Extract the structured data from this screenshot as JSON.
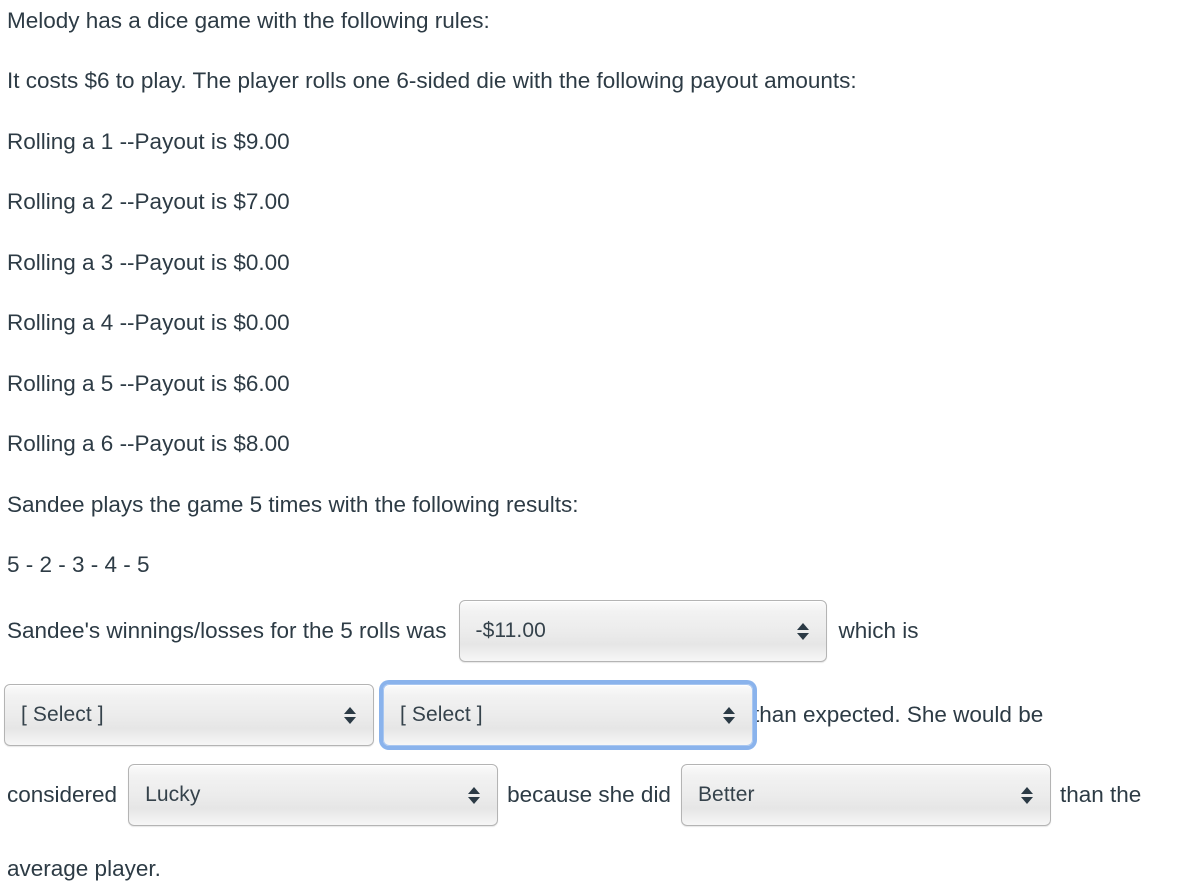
{
  "question": {
    "intro": "Melody has a dice game with the following rules:",
    "cost_line": "It costs $6 to play.  The player rolls one 6-sided die with the following payout amounts:",
    "payouts": [
      "Rolling a 1 --Payout is $9.00",
      "Rolling a 2 --Payout is $7.00",
      "Rolling a 3 --Payout is $0.00",
      "Rolling a 4 --Payout is $0.00",
      "Rolling a 5 --Payout is $6.00",
      "Rolling a 6 --Payout is $8.00"
    ],
    "plays_line": "Sandee plays the game 5 times with the following results:",
    "results_line": "5 - 2 - 3 - 4 - 5",
    "winnings_prefix": "Sandee's winnings/losses for the 5 rolls was",
    "winnings_suffix": "which is",
    "expected_suffix": "than expected.  She would be",
    "considered_prefix": "considered",
    "because_text": "because she did",
    "than_the_text": "than the",
    "last_line": "average player."
  },
  "dropdowns": {
    "winnings": {
      "value": "-$11.00"
    },
    "compare_a": {
      "value": "[ Select ]"
    },
    "compare_b": {
      "value": "[ Select ]"
    },
    "lucky": {
      "value": "Lucky"
    },
    "better": {
      "value": "Better"
    }
  },
  "colors": {
    "text": "#2d3b45",
    "focus_ring": "#8ab3ec",
    "select_border": "#b4b4b4",
    "background": "#ffffff"
  }
}
